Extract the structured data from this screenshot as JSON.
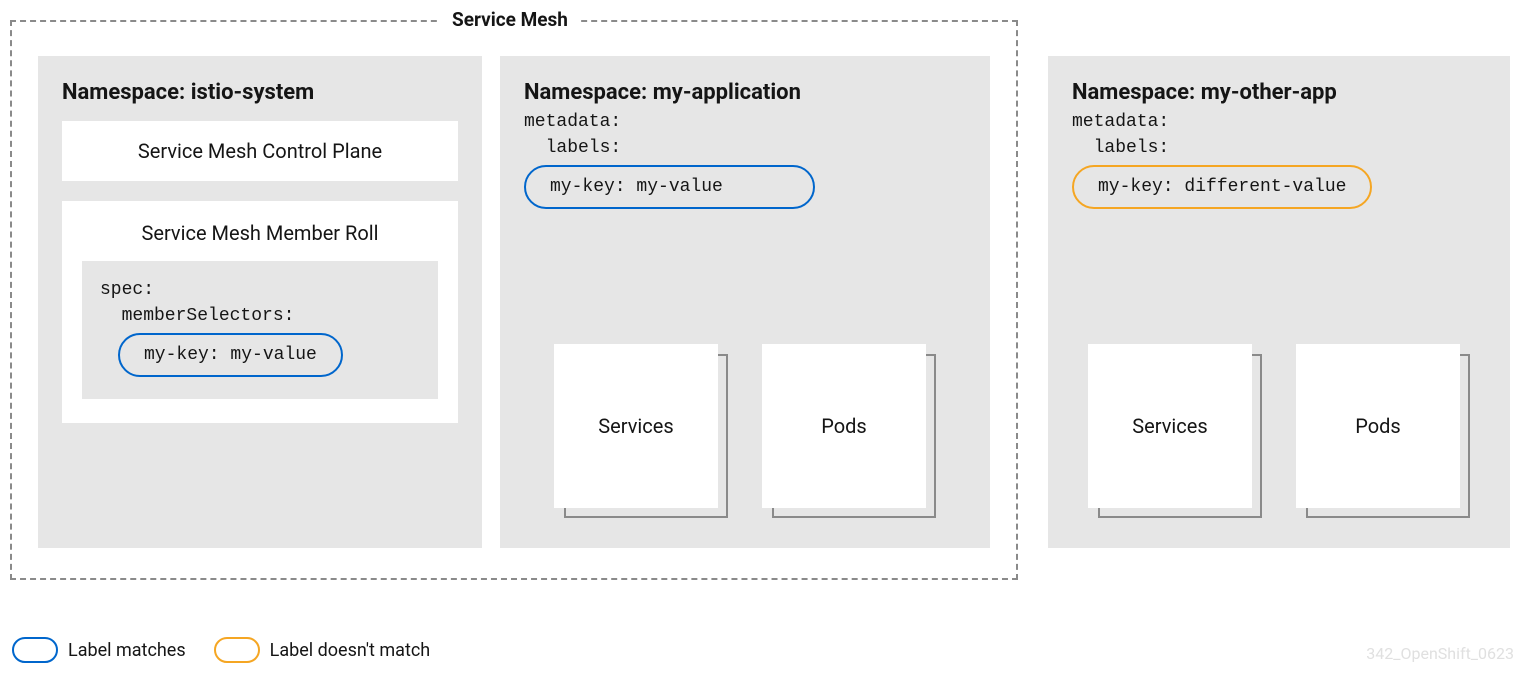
{
  "mesh": {
    "label": "Service Mesh"
  },
  "ns1": {
    "title": "Namespace: istio-system",
    "controlPlane": "Service Mesh Control Plane",
    "memberRoll": {
      "title": "Service Mesh Member Roll",
      "yaml": "spec:\n  memberSelectors:",
      "pill": "my-key: my-value"
    }
  },
  "ns2": {
    "title": "Namespace: my-application",
    "yaml": "metadata:\n  labels:",
    "pill": "my-key: my-value",
    "services": "Services",
    "pods": "Pods"
  },
  "ns3": {
    "title": "Namespace:  my-other-app",
    "yaml": "metadata:\n  labels:",
    "pill": "my-key: different-value",
    "services": "Services",
    "pods": "Pods"
  },
  "legend": {
    "match": "Label matches",
    "nomatch": "Label doesn't match"
  },
  "watermark": "342_OpenShift_0623"
}
